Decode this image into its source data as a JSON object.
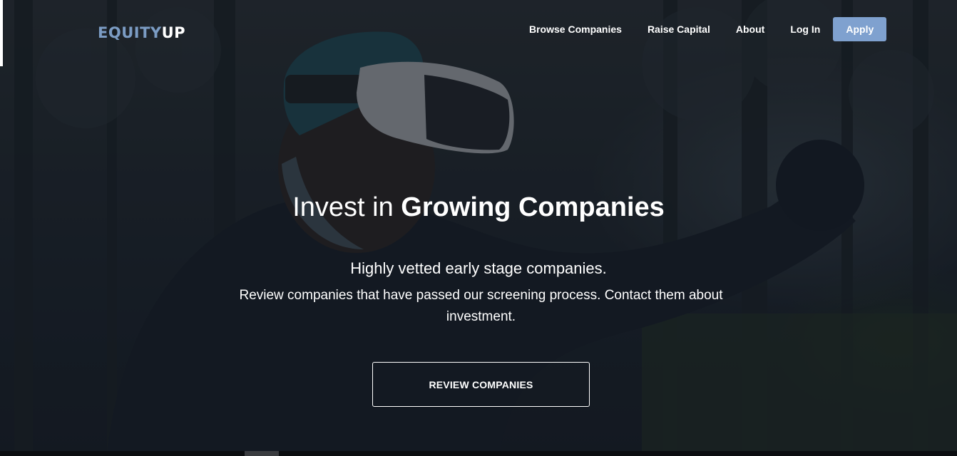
{
  "brand": {
    "logo_part1": "EQUITY",
    "logo_part2": "UP",
    "colors": {
      "accent": "#7fa1cf",
      "logo_accent": "#7b9cc4",
      "text": "#ffffff",
      "overlay": "#101620"
    }
  },
  "nav": {
    "links": [
      {
        "label": "Browse Companies"
      },
      {
        "label": "Raise Capital"
      },
      {
        "label": "About"
      },
      {
        "label": "Log In"
      }
    ],
    "apply_label": "Apply"
  },
  "hero": {
    "headline_prefix": "Invest in",
    "headline_bold": "Growing Companies",
    "subtitle": "Highly vetted early stage companies.",
    "description": "Review companies that have passed our screening process. Contact them about investment.",
    "cta_label": "REVIEW COMPANIES",
    "background_image": "person-with-vr-headset-in-forest"
  }
}
